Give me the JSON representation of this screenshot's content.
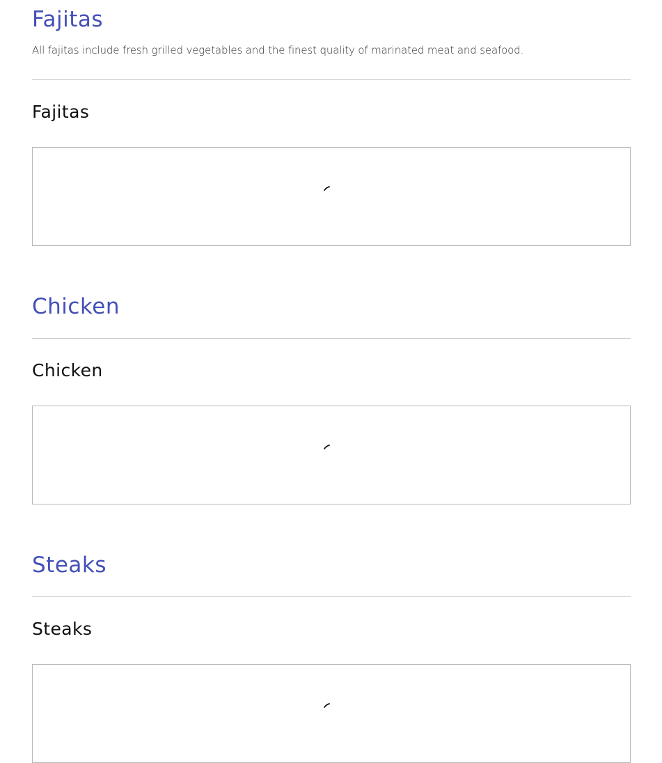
{
  "sections": [
    {
      "title": "Fajitas",
      "description": "All fajitas include fresh grilled vegetables and the finest quality of marinated meat and seafood.",
      "subtitle": "Fajitas"
    },
    {
      "title": "Chicken",
      "description": "",
      "subtitle": "Chicken"
    },
    {
      "title": "Steaks",
      "description": "",
      "subtitle": "Steaks"
    }
  ],
  "colors": {
    "heading": "#4450b8",
    "text": "#111111",
    "divider": "#c4c4c4",
    "border": "#b8b8b8"
  },
  "icons": {
    "loading": "loading-spinner-icon"
  }
}
